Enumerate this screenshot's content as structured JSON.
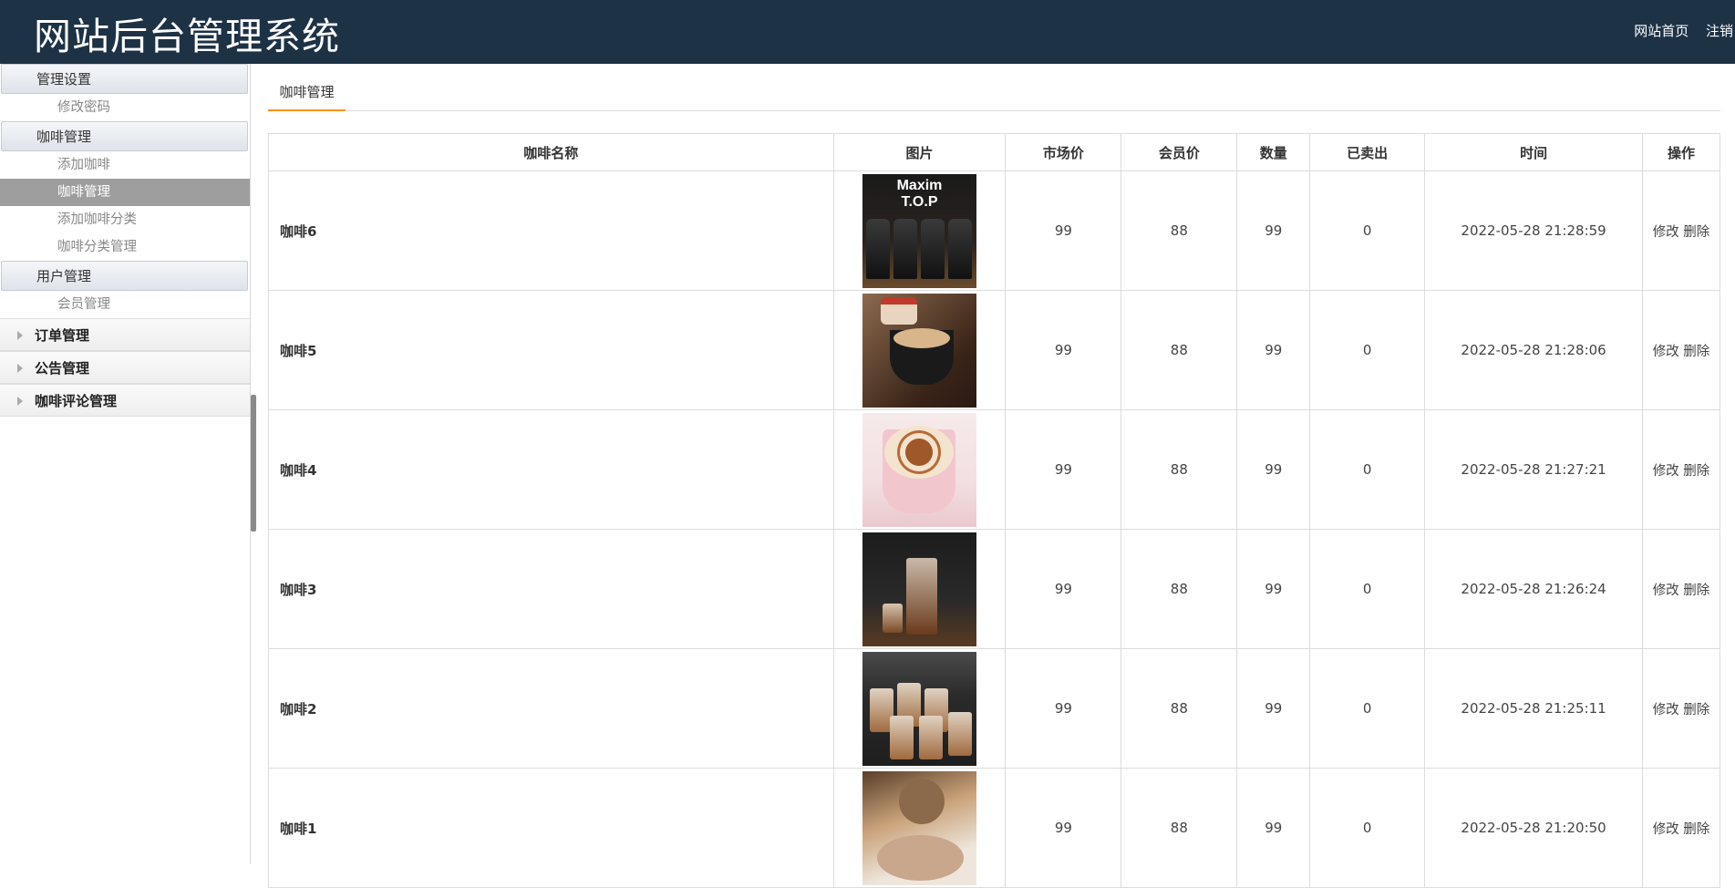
{
  "header": {
    "title": "网站后台管理系统",
    "links": [
      "网站首页",
      "注销"
    ]
  },
  "sidebar": {
    "groups": [
      {
        "label": "管理设置",
        "items": [
          {
            "label": "修改密码",
            "active": false
          }
        ]
      },
      {
        "label": "咖啡管理",
        "items": [
          {
            "label": "添加咖啡",
            "active": false
          },
          {
            "label": "咖啡管理",
            "active": true
          },
          {
            "label": "添加咖啡分类",
            "active": false
          },
          {
            "label": "咖啡分类管理",
            "active": false
          }
        ]
      },
      {
        "label": "用户管理",
        "items": [
          {
            "label": "会员管理",
            "active": false
          }
        ]
      }
    ],
    "folded": [
      "订单管理",
      "公告管理",
      "咖啡评论管理"
    ]
  },
  "main": {
    "tab": "咖啡管理",
    "columns": [
      "咖啡名称",
      "图片",
      "市场价",
      "会员价",
      "数量",
      "已卖出",
      "时间",
      "操作"
    ],
    "rows": [
      {
        "name": "咖啡6",
        "image": "coffee-6-bottles-image",
        "market_price": "99",
        "member_price": "88",
        "quantity": "99",
        "sold": "0",
        "time": "2022-05-28 21:28:59",
        "edit": "修改",
        "delete": "删除"
      },
      {
        "name": "咖啡5",
        "image": "coffee-5-latte-image",
        "market_price": "99",
        "member_price": "88",
        "quantity": "99",
        "sold": "0",
        "time": "2022-05-28 21:28:06",
        "edit": "修改",
        "delete": "删除"
      },
      {
        "name": "咖啡4",
        "image": "coffee-4-latte-art-image",
        "market_price": "99",
        "member_price": "88",
        "quantity": "99",
        "sold": "0",
        "time": "2022-05-28 21:27:21",
        "edit": "修改",
        "delete": "删除"
      },
      {
        "name": "咖啡3",
        "image": "coffee-3-iced-image",
        "market_price": "99",
        "member_price": "88",
        "quantity": "99",
        "sold": "0",
        "time": "2022-05-28 21:26:24",
        "edit": "修改",
        "delete": "删除"
      },
      {
        "name": "咖啡2",
        "image": "coffee-2-glasses-image",
        "market_price": "99",
        "member_price": "88",
        "quantity": "99",
        "sold": "0",
        "time": "2022-05-28 21:25:11",
        "edit": "修改",
        "delete": "删除"
      },
      {
        "name": "咖啡1",
        "image": "coffee-1-powder-image",
        "market_price": "99",
        "member_price": "88",
        "quantity": "99",
        "sold": "0",
        "time": "2022-05-28 21:20:50",
        "edit": "修改",
        "delete": "删除"
      }
    ]
  },
  "colors": {
    "header_bg": "#1e3246",
    "tab_accent": "#f7931e",
    "active_item_bg": "#9e9e9e"
  }
}
